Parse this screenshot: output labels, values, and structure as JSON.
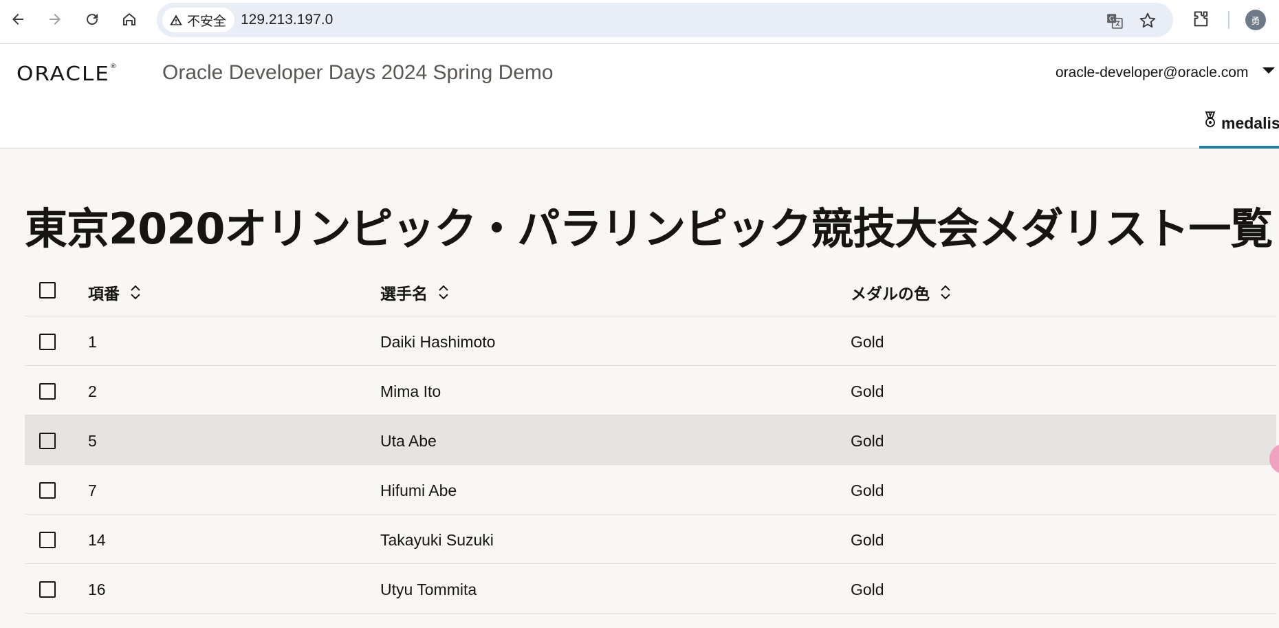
{
  "browser": {
    "security_label": "不安全",
    "url": "129.213.197.0",
    "profile_initial": "勇",
    "icons": [
      "back-icon",
      "forward-icon",
      "reload-icon",
      "home-icon",
      "warning-icon",
      "translate-icon",
      "bookmark-star-icon",
      "extensions-icon"
    ]
  },
  "header": {
    "logo_text": "ORACLE",
    "logo_mark": "®",
    "app_title": "Oracle Developer Days 2024 Spring Demo",
    "user_email": "oracle-developer@oracle.com",
    "nav_tab_label": "medalis",
    "accent_color": "#227e9e"
  },
  "main": {
    "title": "東京2020オリンピック・パラリンピック競技大会メダリスト一覧",
    "columns": [
      "項番",
      "選手名",
      "メダルの色"
    ],
    "rows": [
      {
        "id": "1",
        "name": "Daiki Hashimoto",
        "medal": "Gold"
      },
      {
        "id": "2",
        "name": "Mima Ito",
        "medal": "Gold"
      },
      {
        "id": "5",
        "name": "Uta Abe",
        "medal": "Gold"
      },
      {
        "id": "7",
        "name": "Hifumi Abe",
        "medal": "Gold"
      },
      {
        "id": "14",
        "name": "Takayuki Suzuki",
        "medal": "Gold"
      },
      {
        "id": "16",
        "name": "Utyu Tommita",
        "medal": "Gold"
      }
    ]
  }
}
